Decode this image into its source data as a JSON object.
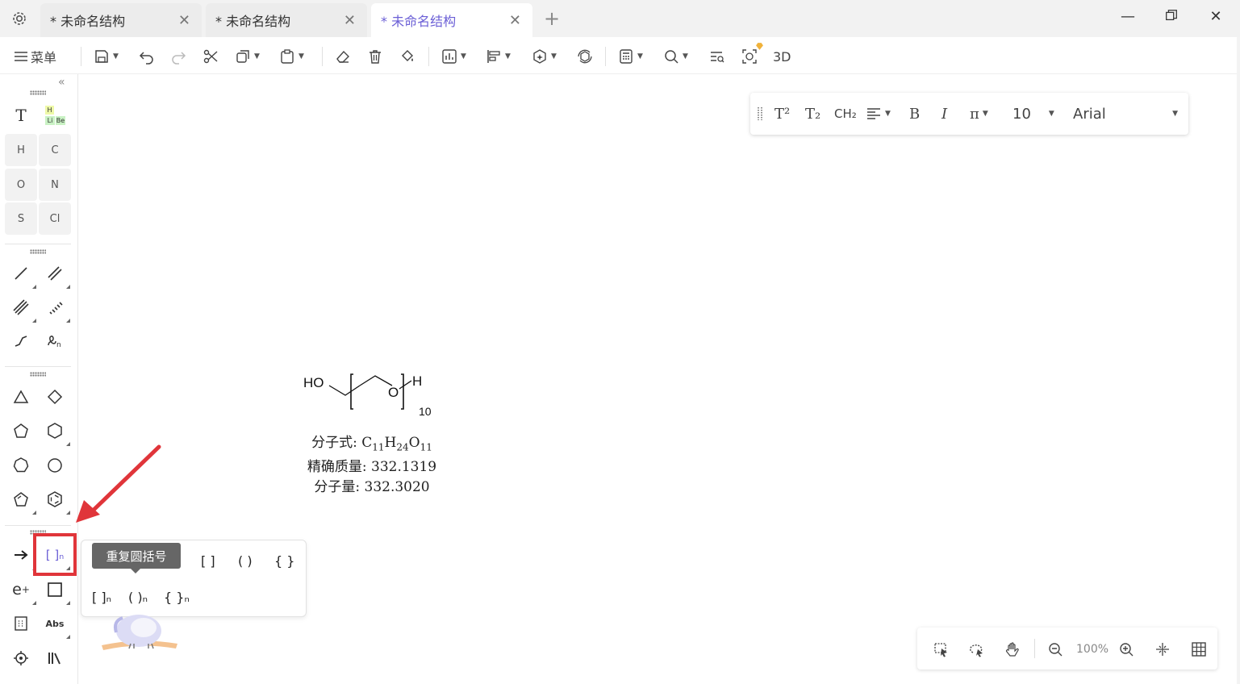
{
  "tabs": [
    {
      "label": "* 未命名结构",
      "active": false
    },
    {
      "label": "* 未命名结构",
      "active": false
    },
    {
      "label": "* 未命名结构",
      "active": true
    }
  ],
  "toolbar": {
    "menu_label": "菜单",
    "three_d_label": "3D"
  },
  "sidebar": {
    "text_tool": "T",
    "periodic": {
      "h": "H",
      "li": "Li",
      "be": "Be"
    },
    "elements": [
      "H",
      "C",
      "O",
      "N",
      "S",
      "Cl"
    ],
    "abs_label": "Abs",
    "charge_label": "e",
    "charge_sup": "+",
    "bracket_n": "[ ]ₙ"
  },
  "format_bar": {
    "superscript": "T²",
    "subscript": "T₂",
    "ch2": "CH₂",
    "bold": "B",
    "italic": "I",
    "pi": "π",
    "font_size": "10",
    "font_name": "Arial"
  },
  "molecule": {
    "ho": "HO",
    "o": "O",
    "h": "H",
    "n": "10"
  },
  "info": {
    "formula_label": "分子式: ",
    "formula": [
      {
        "t": "C",
        "sub": "11"
      },
      {
        "t": "H",
        "sub": "24"
      },
      {
        "t": "O",
        "sub": "11"
      }
    ],
    "exact_mass": "精确质量: 332.1319",
    "mol_weight": "分子量: 332.3020"
  },
  "bracket_popup": {
    "tooltip": "重复圆括号",
    "row1": [
      "[",
      "(",
      "{",
      "[ ]",
      "( )",
      "{ }"
    ],
    "row2": [
      "[ ]ₙ",
      "( )ₙ",
      "{ }ₙ"
    ]
  },
  "view_bar": {
    "zoom": "100%"
  },
  "colors": {
    "accent": "#6b5fd6",
    "highlight": "#e0353a"
  }
}
